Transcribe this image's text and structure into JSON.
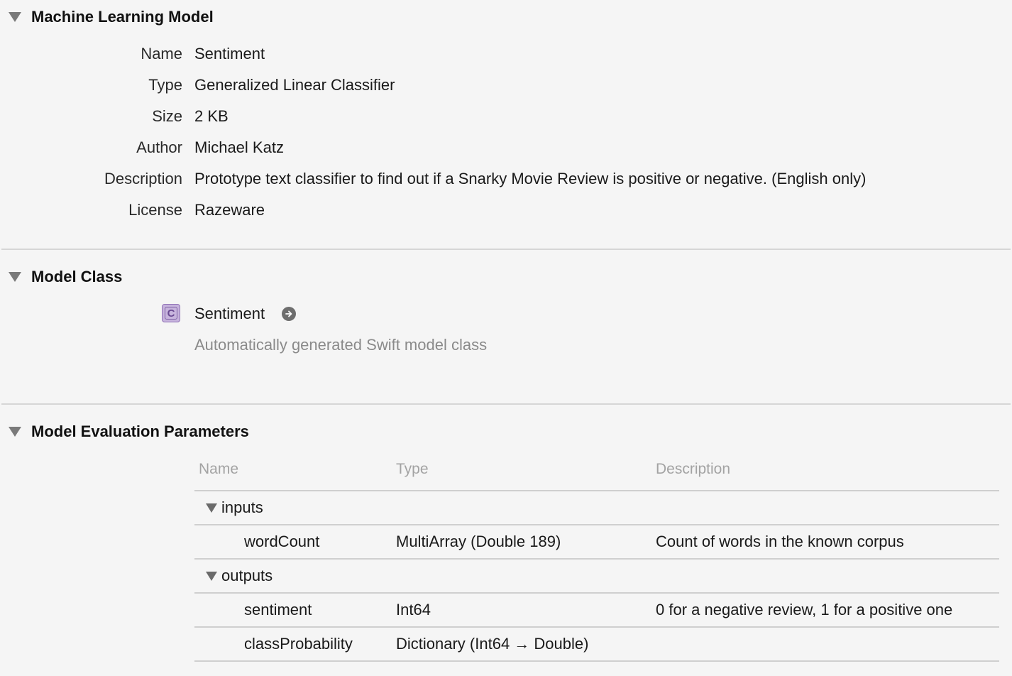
{
  "ml_model": {
    "title": "Machine Learning Model",
    "properties": [
      {
        "label": "Name",
        "value": "Sentiment"
      },
      {
        "label": "Type",
        "value": "Generalized Linear Classifier"
      },
      {
        "label": "Size",
        "value": "2 KB"
      },
      {
        "label": "Author",
        "value": "Michael Katz"
      },
      {
        "label": "Description",
        "value": "Prototype text classifier to find out if a Snarky Movie Review is positive or negative. (English only)"
      },
      {
        "label": "License",
        "value": "Razeware"
      }
    ]
  },
  "model_class": {
    "title": "Model Class",
    "icon_letter": "C",
    "class_name": "Sentiment",
    "description": "Automatically generated Swift model class"
  },
  "eval_params": {
    "title": "Model Evaluation Parameters",
    "columns": {
      "name": "Name",
      "type": "Type",
      "description": "Description"
    },
    "inputs_label": "inputs",
    "inputs": [
      {
        "name": "wordCount",
        "type": "MultiArray (Double 189)",
        "description": "Count of words in the known corpus"
      }
    ],
    "outputs_label": "outputs",
    "outputs": [
      {
        "name": "sentiment",
        "type": "Int64",
        "description": "0 for a negative review, 1 for a positive one"
      },
      {
        "name": "classProbability",
        "type": "Dictionary (Int64 → Double)",
        "description": ""
      }
    ]
  },
  "colors": {
    "background": "#f5f5f5",
    "class_icon_fill": "#c7b4dd",
    "class_icon_border": "#8f70b5",
    "muted_text": "#8a8a8a",
    "header_text": "#a3a3a3"
  },
  "icons": {
    "disclosure": "disclosure-triangle-icon",
    "class": "swift-class-icon",
    "navigate": "navigate-arrow-icon"
  }
}
